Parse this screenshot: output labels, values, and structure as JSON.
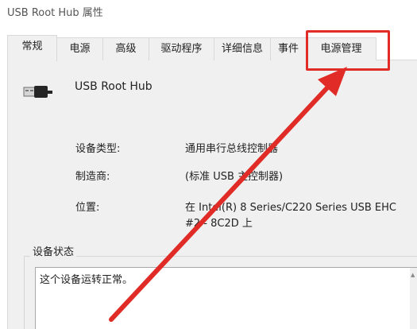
{
  "window": {
    "title": "USB Root Hub 属性"
  },
  "tabs": [
    {
      "label": "常规",
      "active": true
    },
    {
      "label": "电源",
      "active": false
    },
    {
      "label": "高级",
      "active": false
    },
    {
      "label": "驱动程序",
      "active": false
    },
    {
      "label": "详细信息",
      "active": false
    },
    {
      "label": "事件",
      "active": false
    },
    {
      "label": "电源管理",
      "active": false
    }
  ],
  "device": {
    "icon": "usb-connector-icon",
    "name": "USB Root Hub"
  },
  "properties": {
    "type_label": "设备类型:",
    "type_value": "通用串行总线控制器",
    "manufacturer_label": "制造商:",
    "manufacturer_value": "(标准 USB 主控制器)",
    "location_label": "位置:",
    "location_value_line1": "在 Intel(R) 8 Series/C220 Series USB EHC",
    "location_value_line2": "#2 - 8C2D 上"
  },
  "status": {
    "group_label": "设备状态",
    "text": "这个设备运转正常。"
  },
  "annotation": {
    "color": "#e02b26",
    "highlighted_tab": "电源管理"
  }
}
